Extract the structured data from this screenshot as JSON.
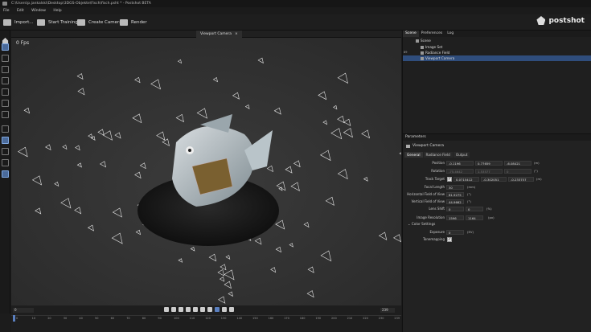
{
  "titlebar": {
    "title": "C:\\Users\\p.jankalski\\Desktop\\3DGS-Objekte\\Fisch\\fisch.psht * - Postshot BETA"
  },
  "menu": [
    "File",
    "Edit",
    "Window",
    "Help"
  ],
  "toolbar": {
    "import": "Import...",
    "start_training": "Start Training",
    "create_camera": "Create Camera",
    "render": "Render"
  },
  "logo": "postshot",
  "viewport": {
    "tab": "Viewport Camera",
    "close": "×",
    "fps": "0 Fps"
  },
  "timeline": {
    "start": "0",
    "end": "239",
    "ticks": [
      "0",
      "10",
      "20",
      "30",
      "40",
      "50",
      "60",
      "70",
      "80",
      "90",
      "100",
      "110",
      "120",
      "130",
      "140",
      "150",
      "160",
      "170",
      "180",
      "190",
      "200",
      "210",
      "220",
      "230",
      "239"
    ]
  },
  "right": {
    "tabs": [
      "Scene",
      "Preferences",
      "Log"
    ],
    "scene_items": [
      {
        "label": "Scene",
        "icon": "scene-icon"
      },
      {
        "label": "Image Set",
        "icon": "images-icon"
      },
      {
        "label": "Radiance Field",
        "icon": "field-icon"
      },
      {
        "label": "Viewport Camera",
        "icon": "camera-icon"
      }
    ],
    "side_count": "89"
  },
  "params": {
    "title": "Parameters",
    "object": "Viewport Camera",
    "tabs": [
      "General",
      "Radiance Field",
      "Output"
    ],
    "position": {
      "label": "Position",
      "x": "-0.1196",
      "y": "0.77659",
      "z": "-6.08421",
      "unit": "(m)"
    },
    "rotation": {
      "label": "Rotation",
      "x": "-75.4642",
      "y": "1.53577",
      "z": "0",
      "unit": "(°)"
    },
    "track_target": {
      "label": "Track Target",
      "x": "0.0715412",
      "y": "-0.302051",
      "z": "-0.233757",
      "unit": "(m)"
    },
    "focal_length": {
      "label": "Focal Length",
      "value": "30",
      "unit": "(mm)"
    },
    "hfov": {
      "label": "Horizontal Field of View",
      "value": "61.9275",
      "unit": "(°)"
    },
    "vfov": {
      "label": "Vertical Field of View",
      "value": "44.9662",
      "unit": "(°)"
    },
    "lens_shift": {
      "label": "Lens Shift",
      "x": "0",
      "y": "0",
      "unit": "(%)"
    },
    "image_resolution": {
      "label": "Image Resolution",
      "w": "1596",
      "h": "1164",
      "unit": "(px)"
    },
    "color_settings": "Color Settings",
    "exposure": {
      "label": "Exposure",
      "value": "0",
      "unit": "(EV)"
    },
    "tonemapping": {
      "label": "Tonemapping",
      "checked": "✓"
    }
  }
}
